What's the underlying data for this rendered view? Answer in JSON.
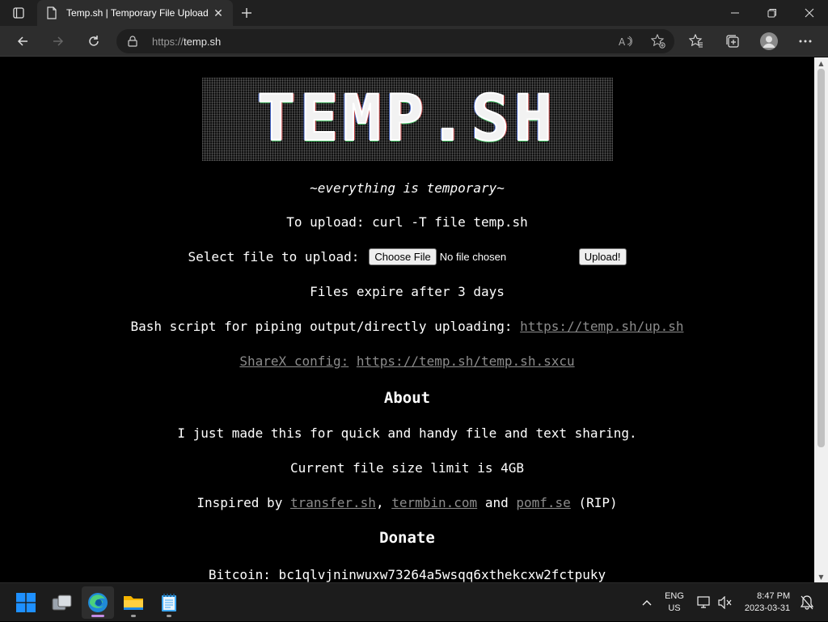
{
  "browser": {
    "tab_title": "Temp.sh | Temporary File Upload",
    "url_protocol": "https://",
    "url_host": "temp.sh"
  },
  "page": {
    "logo_text": "TEMP.SH",
    "tagline": "~everything is temporary~",
    "curl_line": "To upload: curl -T file temp.sh",
    "select_label": "Select file to upload:",
    "choose_file_label": "Choose File",
    "no_file_text": "No file chosen",
    "upload_button": "Upload!",
    "expire_text": "Files expire after 3 days",
    "bash_prefix": "Bash script for piping output/directly uploading:",
    "bash_link": "https://temp.sh/up.sh",
    "sharex_label": "ShareX config:",
    "sharex_link": "https://temp.sh/temp.sh.sxcu",
    "about_heading": "About",
    "about_text": "I just made this for quick and handy file and text sharing.",
    "size_limit_text": "Current file size limit is 4GB",
    "inspired_prefix": "Inspired by",
    "inspired_link1": "transfer.sh",
    "comma": ",",
    "inspired_link2": "termbin.com",
    "and_text": "and",
    "inspired_link3": "pomf.se",
    "rip_text": "(RIP)",
    "donate_heading": "Donate",
    "bitcoin_text": "Bitcoin: bc1qlvjninwuxw73264a5wsqq6xthekcxw2fctpuky"
  },
  "taskbar": {
    "lang_line1": "ENG",
    "lang_line2": "US",
    "time": "8:47 PM",
    "date": "2023-03-31"
  },
  "colors": {
    "page_bg": "#000000",
    "link": "#8c8c8c",
    "chrome_bg": "#202020",
    "toolbar_bg": "#2d2d2d"
  }
}
